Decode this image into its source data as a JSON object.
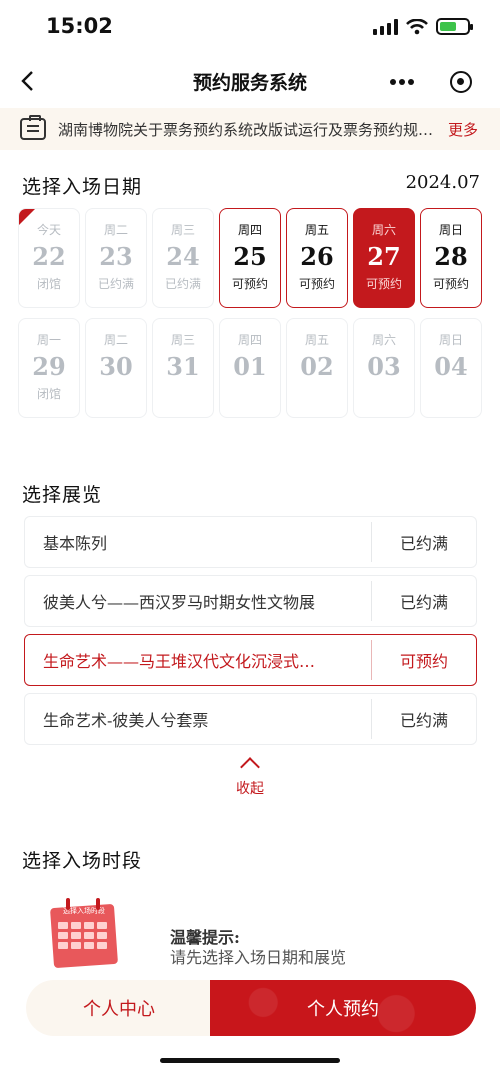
{
  "status": {
    "time": "15:02"
  },
  "nav": {
    "title": "预约服务系统"
  },
  "notice": {
    "text": "湖南博物院关于票务预约系统改版试运行及票务预约规…",
    "more": "更多"
  },
  "date_section": {
    "title": "选择入场日期",
    "month": "2024.07",
    "days": [
      {
        "week": "今天",
        "num": "22",
        "status": "闭馆",
        "state": "disabled"
      },
      {
        "week": "周二",
        "num": "23",
        "status": "已约满",
        "state": "disabled"
      },
      {
        "week": "周三",
        "num": "24",
        "status": "已约满",
        "state": "disabled"
      },
      {
        "week": "周四",
        "num": "25",
        "status": "可预约",
        "state": "open"
      },
      {
        "week": "周五",
        "num": "26",
        "status": "可预约",
        "state": "open"
      },
      {
        "week": "周六",
        "num": "27",
        "status": "可预约",
        "state": "selected"
      },
      {
        "week": "周日",
        "num": "28",
        "status": "可预约",
        "state": "open"
      },
      {
        "week": "周一",
        "num": "29",
        "status": "闭馆",
        "state": "disabled"
      },
      {
        "week": "周二",
        "num": "30",
        "status": "",
        "state": "disabled"
      },
      {
        "week": "周三",
        "num": "31",
        "status": "",
        "state": "disabled"
      },
      {
        "week": "周四",
        "num": "01",
        "status": "",
        "state": "disabled"
      },
      {
        "week": "周五",
        "num": "02",
        "status": "",
        "state": "disabled"
      },
      {
        "week": "周六",
        "num": "03",
        "status": "",
        "state": "disabled"
      },
      {
        "week": "周日",
        "num": "04",
        "status": "",
        "state": "disabled"
      }
    ]
  },
  "exhibit_section": {
    "title": "选择展览",
    "items": [
      {
        "name": "基本陈列",
        "status": "已约满"
      },
      {
        "name": "彼美人兮——西汉罗马时期女性文物展",
        "status": "已约满"
      },
      {
        "name": "生命艺术——马王堆汉代文化沉浸式…",
        "status": "可预约"
      },
      {
        "name": "生命艺术-彼美人兮套票",
        "status": "已约满"
      }
    ],
    "collapse_label": "收起"
  },
  "time_section": {
    "title": "选择入场时段",
    "calendar_label": "选择入场时段",
    "tip_title": "温馨提示:",
    "tip_text": "请先选择入场日期和展览"
  },
  "bottom": {
    "personal_center": "个人中心",
    "book": "个人预约"
  },
  "colors": {
    "accent": "#c3191d",
    "notice_bg": "#fbf6ef"
  }
}
